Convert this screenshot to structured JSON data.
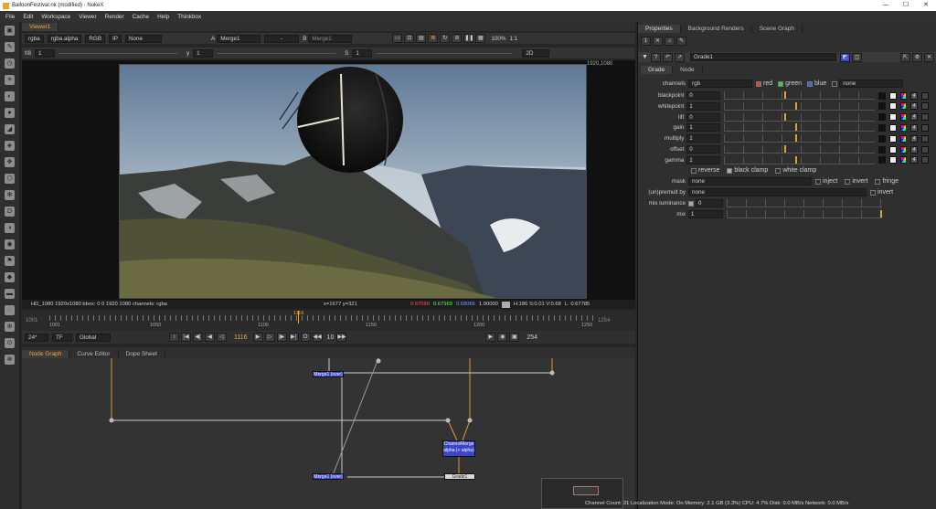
{
  "window": {
    "title": "BalloonFestival.nk (modified) - NukeX",
    "min": "—",
    "max": "☐",
    "close": "✕"
  },
  "menu": [
    "File",
    "Edit",
    "Workspace",
    "Viewer",
    "Render",
    "Cache",
    "Help",
    "Thinkbox"
  ],
  "viewer": {
    "tab": "Viewer1",
    "channels": "rgba",
    "alpha": "rgba.alpha",
    "colorspace": "RGB",
    "ip": "IP",
    "none": "None",
    "input_a_label": "A",
    "input_a": "Merge1",
    "dash": "-",
    "input_b_label": "B",
    "input_b": "Merge1",
    "zoom": "100%",
    "ratio": "1:1",
    "fstop": "f/8",
    "exposure": "1",
    "y_label": "y",
    "gamma": "1",
    "s_label": "S",
    "s_value": "1",
    "mode2d": "2D",
    "format_corner": "1920,1080",
    "status": {
      "info": "HD_1080 1920x1080  bbox: 0 0 1920 1080 channels: rgba",
      "xy": "x=1677 y=321",
      "r": "0.67090",
      "g": "0.67969",
      "b": "0.68066",
      "a": "1.00000",
      "hsv": "H:186 S:0.01 V:0.68",
      "l": "L: 0.67785"
    }
  },
  "timeline": {
    "in_frame": "1001",
    "out_frame": "1254",
    "current": "1116",
    "ticks": [
      "1001",
      "1050",
      "1100",
      "1150",
      "1200",
      "1250"
    ],
    "fps": "24*",
    "tf": "TF",
    "scope": "Global",
    "frame_field": "1116",
    "step": "10",
    "end_field": "254"
  },
  "lower_tabs": [
    "Node Graph",
    "Curve Editor",
    "Dope Sheet"
  ],
  "nodes": {
    "merge_top": "Merge1 (over)",
    "channelmerge": "ChannelMerge alpha (+ alpha)",
    "merge_bottom": "Merge1 (over)",
    "grade": "Grade1"
  },
  "properties": {
    "tabs": [
      "Properties",
      "Background Renders",
      "Scene Graph"
    ],
    "node_name": "Grade1",
    "subtabs": [
      "Grade",
      "Node"
    ],
    "channels_label": "channels",
    "channels_value": "rgb",
    "red": "red",
    "green": "green",
    "blue": "blue",
    "none": "none",
    "params": [
      {
        "label": "blackpoint",
        "value": "0",
        "knob": 0.4
      },
      {
        "label": "whitepoint",
        "value": "1",
        "knob": 0.47
      },
      {
        "label": "lift",
        "value": "0",
        "knob": 0.4
      },
      {
        "label": "gain",
        "value": "1",
        "knob": 0.47
      },
      {
        "label": "multiply",
        "value": "1",
        "knob": 0.47
      },
      {
        "label": "offset",
        "value": "0",
        "knob": 0.4
      },
      {
        "label": "gamma",
        "value": "1",
        "knob": 0.47
      }
    ],
    "reverse": "reverse",
    "black_clamp": "black clamp",
    "white_clamp": "white clamp",
    "mask_label": "mask",
    "mask_value": "none",
    "inject": "inject",
    "invert": "invert",
    "fringe": "fringe",
    "unpremult_label": "(un)premult by",
    "unpremult_value": "none",
    "mix_luminance_label": "mix luminance",
    "mix_luminance_value": "0",
    "mix_label": "mix",
    "mix_value": "1"
  },
  "status_bar": "Channel Count: 31  Localization Mode: On  Memory: 2.1 GB (3.3%)  CPU: 4.7%  Disk: 0.0 MB/s  Network: 0.0 MB/s",
  "colors": {
    "accent": "#f0a53a",
    "node_blue": "#3a45c8",
    "panel": "#2f2f2f"
  }
}
